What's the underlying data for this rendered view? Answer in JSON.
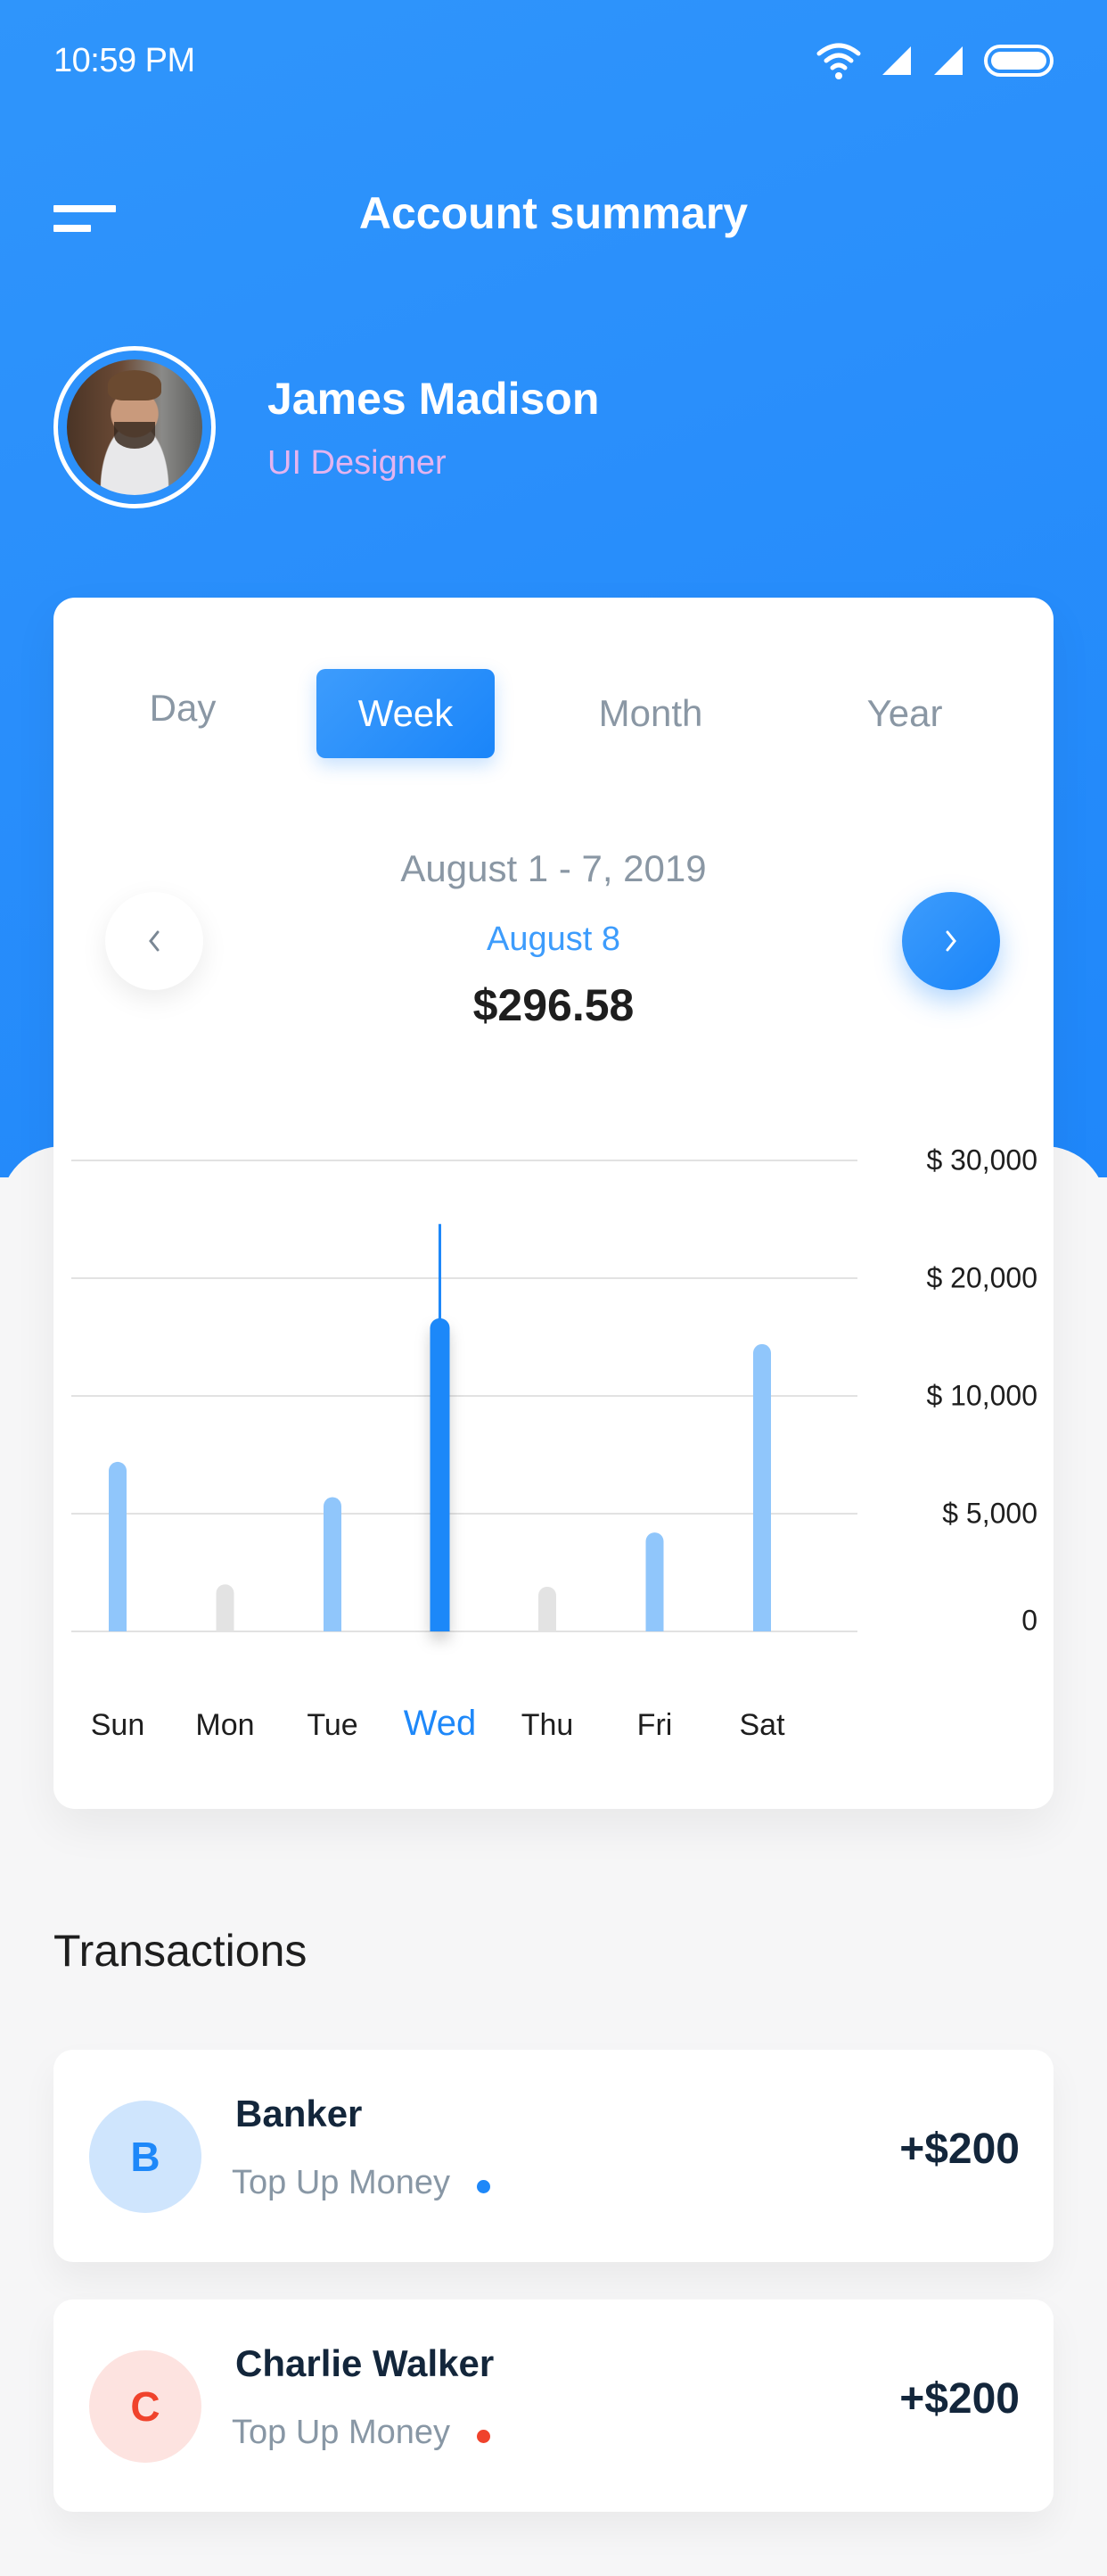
{
  "status_bar": {
    "time": "10:59 PM",
    "icons": [
      "wifi-icon",
      "signal-icon",
      "signal-icon",
      "battery-icon"
    ]
  },
  "header": {
    "title": "Account summary",
    "menu_icon": "menu-icon"
  },
  "profile": {
    "name": "James Madison",
    "role": "UI Designer"
  },
  "period_tabs": [
    {
      "label": "Day",
      "active": false
    },
    {
      "label": "Week",
      "active": true
    },
    {
      "label": "Month",
      "active": false
    },
    {
      "label": "Year",
      "active": false
    }
  ],
  "summary": {
    "range": "August 1 - 7, 2019",
    "selected_date": "August 8",
    "selected_amount": "$296.58",
    "prev_icon": "chevron-left-icon",
    "next_icon": "chevron-right-icon"
  },
  "colors": {
    "accent": "#1e88f9",
    "bar_light": "#90c6fb",
    "bar_muted": "#e3e3e3",
    "grid": "#e2e2e2"
  },
  "chart_data": {
    "type": "bar",
    "categories": [
      "Sun",
      "Mon",
      "Tue",
      "Wed",
      "Thu",
      "Fri",
      "Sat"
    ],
    "values": [
      7200,
      2000,
      5700,
      16600,
      1900,
      4200,
      14400
    ],
    "highlighted": "Wed",
    "highlight_marker_value": 24600,
    "muted_categories": [
      "Mon",
      "Thu"
    ],
    "y_ticks": [
      0,
      5000,
      10000,
      20000,
      30000
    ],
    "y_tick_labels": [
      "0",
      "$ 5,000",
      "$ 10,000",
      "$ 20,000",
      "$ 30,000"
    ],
    "y_axis_position": "right",
    "grid": true,
    "title": "",
    "xlabel": "",
    "ylabel": "",
    "ylim": [
      0,
      30000
    ]
  },
  "transactions": {
    "title": "Transactions",
    "items": [
      {
        "initial": "B",
        "name": "Banker",
        "description": "Top Up Money",
        "amount": "+$200",
        "avatar_bg": "#cfe5fd",
        "avatar_fg": "#1e88f9",
        "dot": "#1e88f9"
      },
      {
        "initial": "C",
        "name": "Charlie Walker",
        "description": "Top Up Money",
        "amount": "+$200",
        "avatar_bg": "#fde3e0",
        "avatar_fg": "#f0432c",
        "dot": "#f0432c"
      }
    ]
  }
}
